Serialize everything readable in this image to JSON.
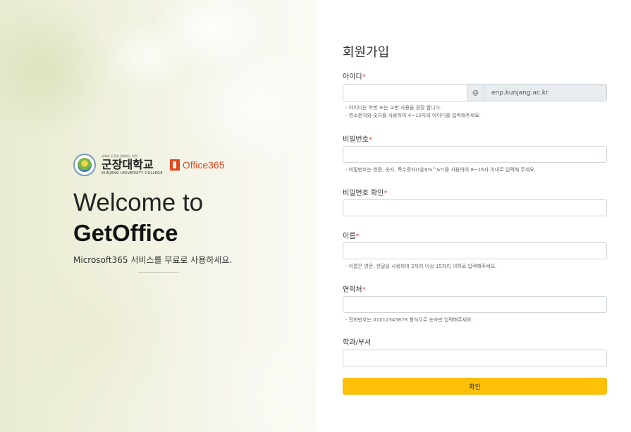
{
  "hero": {
    "university_small": "사회와 도전과 함께하는 대학",
    "university_ko": "군장대학교",
    "university_en": "KUNJANG UNIVERSITY COLLEGE",
    "office_label": "Office365",
    "welcome": "Welcome to",
    "product": "GetOffice",
    "tagline": "Microsoft365 서비스를 무료로 사용하세요."
  },
  "form": {
    "title": "회원가입",
    "required_mark": "*",
    "id": {
      "label": "아이디",
      "value": "",
      "at": "@",
      "domain": "enp.kunjang.ac.kr",
      "hint1": "- 아이디는 학번 또는 교번 사용을 권장 합니다.",
      "hint2": "- 영소문자와 숫자를 사용하여 4~10자의 아이디를 입력해주세요."
    },
    "password": {
      "label": "비밀번호",
      "value": "",
      "hint": "- 비밀번호는 영문, 숫자, 특수문자(!@$%^&*)를 사용하여 8~16자 이내로 입력해 주세요."
    },
    "password_confirm": {
      "label": "비밀번호 확인",
      "value": ""
    },
    "name": {
      "label": "이름",
      "value": "",
      "hint": "- 이름은 영문, 한글을 사용하여 2자리 이상 15자리 이하로 입력해주세요."
    },
    "phone": {
      "label": "연락처",
      "value": "",
      "hint": "- 전화번호는 01012345678 형식으로 숫자만 입력해주세요."
    },
    "department": {
      "label": "학과/부서",
      "value": ""
    },
    "submit_label": "확인"
  }
}
